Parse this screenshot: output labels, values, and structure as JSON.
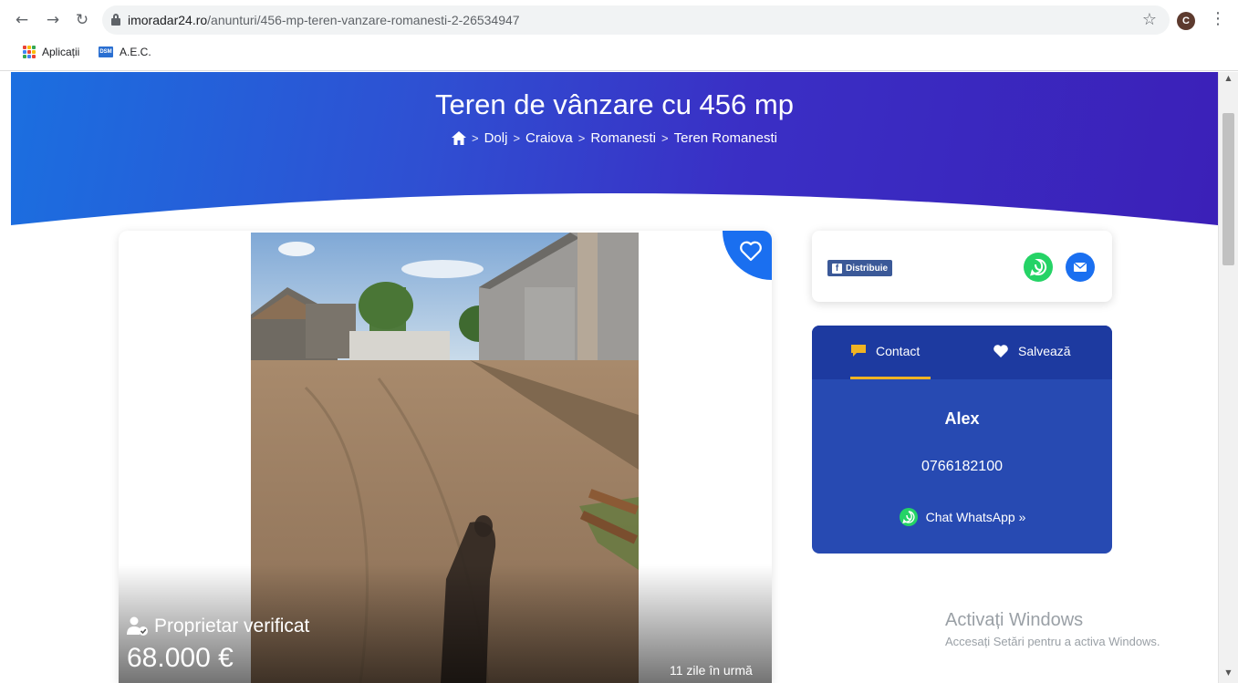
{
  "browser": {
    "url_domain": "imoradar24.ro",
    "url_path": "/anunturi/456-mp-teren-vanzare-romanesti-2-26534947",
    "avatar_letter": "C",
    "bookmarks": [
      {
        "label": "Aplicații",
        "icon": "apps-grid-icon"
      },
      {
        "label": "A.E.C.",
        "icon": "dsm-icon",
        "icon_text": "DSM"
      }
    ]
  },
  "hero": {
    "title": "Teren de vânzare cu 456 mp",
    "breadcrumb": [
      "Dolj",
      "Craiova",
      "Romanesti",
      "Teren Romanesti"
    ],
    "separator": ">"
  },
  "listing": {
    "owner_badge": "Proprietar verificat",
    "price": "68.000 €",
    "age": "11 zile în urmă"
  },
  "share": {
    "facebook_label": "Distribuie"
  },
  "contact": {
    "tabs": [
      {
        "label": "Contact",
        "icon": "chat-bubble-icon",
        "active": true
      },
      {
        "label": "Salvează",
        "icon": "heart-icon",
        "active": false
      }
    ],
    "name": "Alex",
    "phone": "0766182100",
    "whatsapp_label": "Chat WhatsApp »"
  },
  "watermark": {
    "title": "Activați Windows",
    "subtitle": "Accesați Setări pentru a activa Windows."
  },
  "colors": {
    "hero_start": "#1b6fe0",
    "hero_end": "#3b20b8",
    "accent_blue": "#1a6ff0",
    "contact_bg": "#274ab2",
    "tab_underline": "#f0b323",
    "whatsapp": "#25d366",
    "facebook": "#3b5998"
  }
}
